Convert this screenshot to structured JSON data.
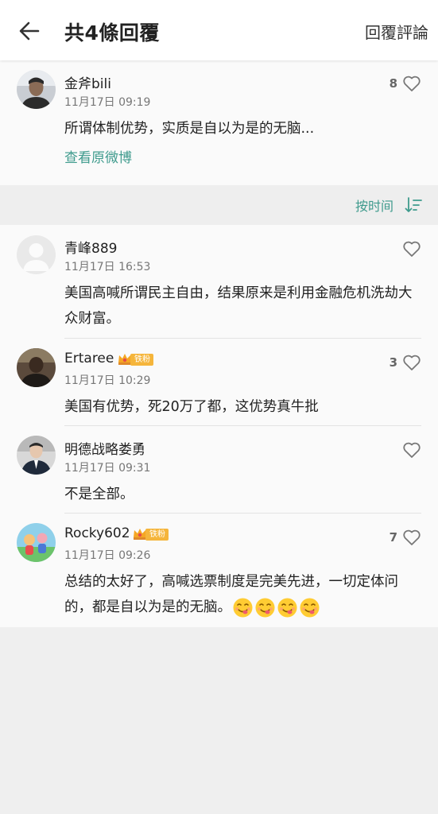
{
  "header": {
    "title": "共4條回覆",
    "reply_comment_label": "回覆評論"
  },
  "original": {
    "user": "金斧bili",
    "time": "11月17日 09:19",
    "text": "所谓体制优势，实质是自以为是的无脑...",
    "likes": "8",
    "view_original_label": "查看原微博"
  },
  "sort": {
    "label": "按时间"
  },
  "comments": [
    {
      "user": "青峰889",
      "time": "11月17日 16:53",
      "text": "美国高喊所谓民主自由，结果原来是利用金融危机洗劫大众财富。",
      "likes": "",
      "badge": ""
    },
    {
      "user": "Ertaree",
      "time": "11月17日 10:29",
      "text": "美国有优势，死20万了都，这优势真牛批",
      "likes": "3",
      "badge": "铁粉"
    },
    {
      "user": "明德战略娄勇",
      "time": "11月17日 09:31",
      "text": "不是全部。",
      "likes": "",
      "badge": ""
    },
    {
      "user": "Rocky602",
      "time": "11月17日 09:26",
      "text": "总结的太好了，高喊选票制度是完美先进，一切定体问的，都是自以为是的无脑。",
      "likes": "7",
      "badge": "铁粉"
    }
  ],
  "icons": {
    "back": "arrow-left-icon",
    "sort": "sort-descending-icon",
    "like": "heart-outline-icon",
    "badge": "crown-icon",
    "emoji": "yummy-face-icon"
  },
  "colors": {
    "accent": "#3f9b8d",
    "badge": "#f5b53b"
  }
}
